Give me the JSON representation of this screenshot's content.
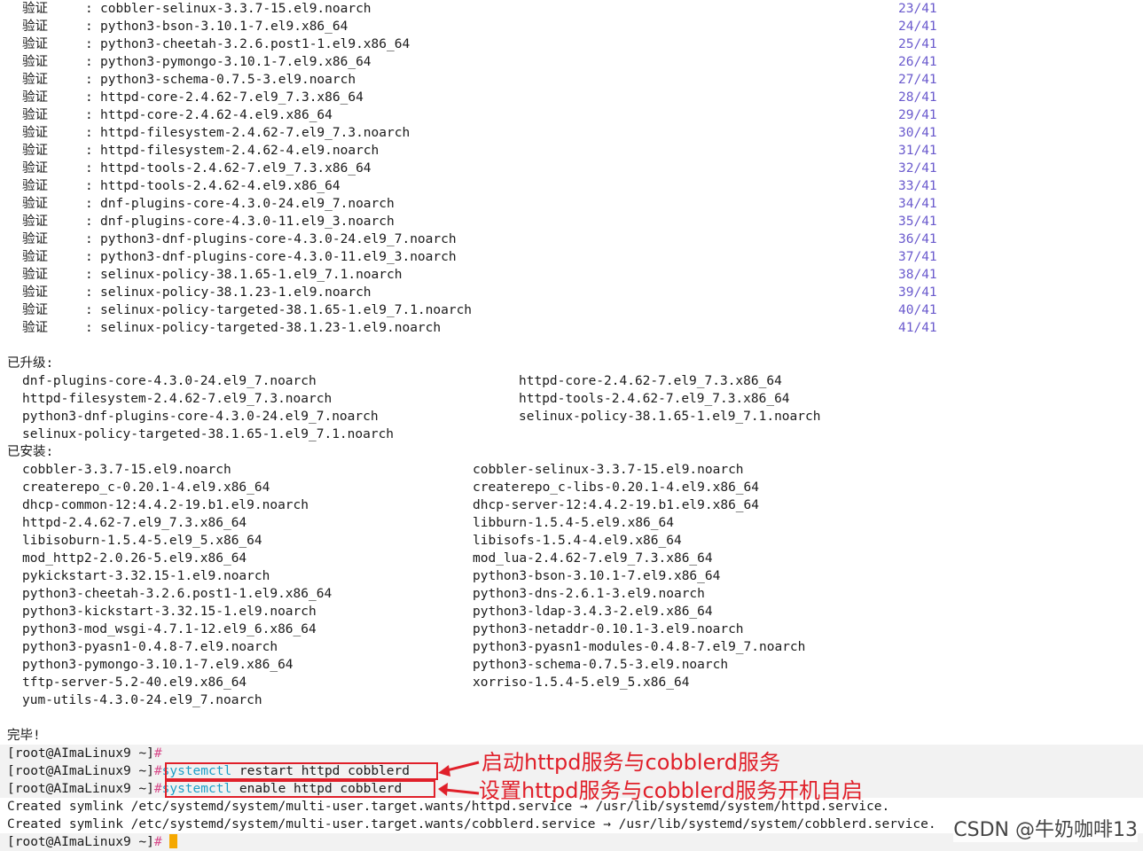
{
  "verify": {
    "label": "验证",
    "colon": ":",
    "rows": [
      {
        "pkg": "cobbler-selinux-3.3.7-15.el9.noarch",
        "count": "23/41"
      },
      {
        "pkg": "python3-bson-3.10.1-7.el9.x86_64",
        "count": "24/41"
      },
      {
        "pkg": "python3-cheetah-3.2.6.post1-1.el9.x86_64",
        "count": "25/41"
      },
      {
        "pkg": "python3-pymongo-3.10.1-7.el9.x86_64",
        "count": "26/41"
      },
      {
        "pkg": "python3-schema-0.7.5-3.el9.noarch",
        "count": "27/41"
      },
      {
        "pkg": "httpd-core-2.4.62-7.el9_7.3.x86_64",
        "count": "28/41"
      },
      {
        "pkg": "httpd-core-2.4.62-4.el9.x86_64",
        "count": "29/41"
      },
      {
        "pkg": "httpd-filesystem-2.4.62-7.el9_7.3.noarch",
        "count": "30/41"
      },
      {
        "pkg": "httpd-filesystem-2.4.62-4.el9.noarch",
        "count": "31/41"
      },
      {
        "pkg": "httpd-tools-2.4.62-7.el9_7.3.x86_64",
        "count": "32/41"
      },
      {
        "pkg": "httpd-tools-2.4.62-4.el9.x86_64",
        "count": "33/41"
      },
      {
        "pkg": "dnf-plugins-core-4.3.0-24.el9_7.noarch",
        "count": "34/41"
      },
      {
        "pkg": "dnf-plugins-core-4.3.0-11.el9_3.noarch",
        "count": "35/41"
      },
      {
        "pkg": "python3-dnf-plugins-core-4.3.0-24.el9_7.noarch",
        "count": "36/41"
      },
      {
        "pkg": "python3-dnf-plugins-core-4.3.0-11.el9_3.noarch",
        "count": "37/41"
      },
      {
        "pkg": "selinux-policy-38.1.65-1.el9_7.1.noarch",
        "count": "38/41"
      },
      {
        "pkg": "selinux-policy-38.1.23-1.el9.noarch",
        "count": "39/41"
      },
      {
        "pkg": "selinux-policy-targeted-38.1.65-1.el9_7.1.noarch",
        "count": "40/41"
      },
      {
        "pkg": "selinux-policy-targeted-38.1.23-1.el9.noarch",
        "count": "41/41"
      }
    ]
  },
  "upgraded": {
    "header": "已升级:",
    "rows": [
      [
        "dnf-plugins-core-4.3.0-24.el9_7.noarch",
        "httpd-core-2.4.62-7.el9_7.3.x86_64"
      ],
      [
        "httpd-filesystem-2.4.62-7.el9_7.3.noarch",
        "httpd-tools-2.4.62-7.el9_7.3.x86_64"
      ],
      [
        "python3-dnf-plugins-core-4.3.0-24.el9_7.noarch",
        "selinux-policy-38.1.65-1.el9_7.1.noarch"
      ],
      [
        "selinux-policy-targeted-38.1.65-1.el9_7.1.noarch",
        ""
      ]
    ]
  },
  "installed": {
    "header": "已安装:",
    "rows": [
      [
        "cobbler-3.3.7-15.el9.noarch",
        "cobbler-selinux-3.3.7-15.el9.noarch"
      ],
      [
        "createrepo_c-0.20.1-4.el9.x86_64",
        "createrepo_c-libs-0.20.1-4.el9.x86_64"
      ],
      [
        "dhcp-common-12:4.4.2-19.b1.el9.noarch",
        "dhcp-server-12:4.4.2-19.b1.el9.x86_64"
      ],
      [
        "httpd-2.4.62-7.el9_7.3.x86_64",
        "libburn-1.5.4-5.el9.x86_64"
      ],
      [
        "libisoburn-1.5.4-5.el9_5.x86_64",
        "libisofs-1.5.4-4.el9.x86_64"
      ],
      [
        "mod_http2-2.0.26-5.el9.x86_64",
        "mod_lua-2.4.62-7.el9_7.3.x86_64"
      ],
      [
        "pykickstart-3.32.15-1.el9.noarch",
        "python3-bson-3.10.1-7.el9.x86_64"
      ],
      [
        "python3-cheetah-3.2.6.post1-1.el9.x86_64",
        "python3-dns-2.6.1-3.el9.noarch"
      ],
      [
        "python3-kickstart-3.32.15-1.el9.noarch",
        "python3-ldap-3.4.3-2.el9.x86_64"
      ],
      [
        "python3-mod_wsgi-4.7.1-12.el9_6.x86_64",
        "python3-netaddr-0.10.1-3.el9.noarch"
      ],
      [
        "python3-pyasn1-0.4.8-7.el9.noarch",
        "python3-pyasn1-modules-0.4.8-7.el9_7.noarch"
      ],
      [
        "python3-pymongo-3.10.1-7.el9.x86_64",
        "python3-schema-0.7.5-3.el9.noarch"
      ],
      [
        "tftp-server-5.2-40.el9.x86_64",
        "xorriso-1.5.4-5.el9_5.x86_64"
      ],
      [
        "yum-utils-4.3.0-24.el9_7.noarch",
        ""
      ]
    ]
  },
  "done": "完毕!",
  "prompt": "[root@AImaLinux9 ~]",
  "hash": "#",
  "cmd1": {
    "bin": "systemctl",
    "args": " restart httpd cobblerd"
  },
  "cmd2": {
    "bin": "systemctl",
    "args": " enable httpd cobblerd"
  },
  "symlink1": "Created symlink /etc/systemd/system/multi-user.target.wants/httpd.service → /usr/lib/systemd/system/httpd.service.",
  "symlink2": "Created symlink /etc/systemd/system/multi-user.target.wants/cobblerd.service → /usr/lib/systemd/system/cobblerd.service.",
  "annotation1": "启动httpd服务与cobblerd服务",
  "annotation2": "设置httpd服务与cobblerd服务开机自启",
  "watermark": "CSDN @牛奶咖啡13",
  "colors": {
    "accent_red": "#e0202a",
    "count_purple": "#6a5acd",
    "cmd_cyan": "#1e9fc7",
    "hash_pink": "#d84a8a",
    "cursor": "#f5a800"
  }
}
